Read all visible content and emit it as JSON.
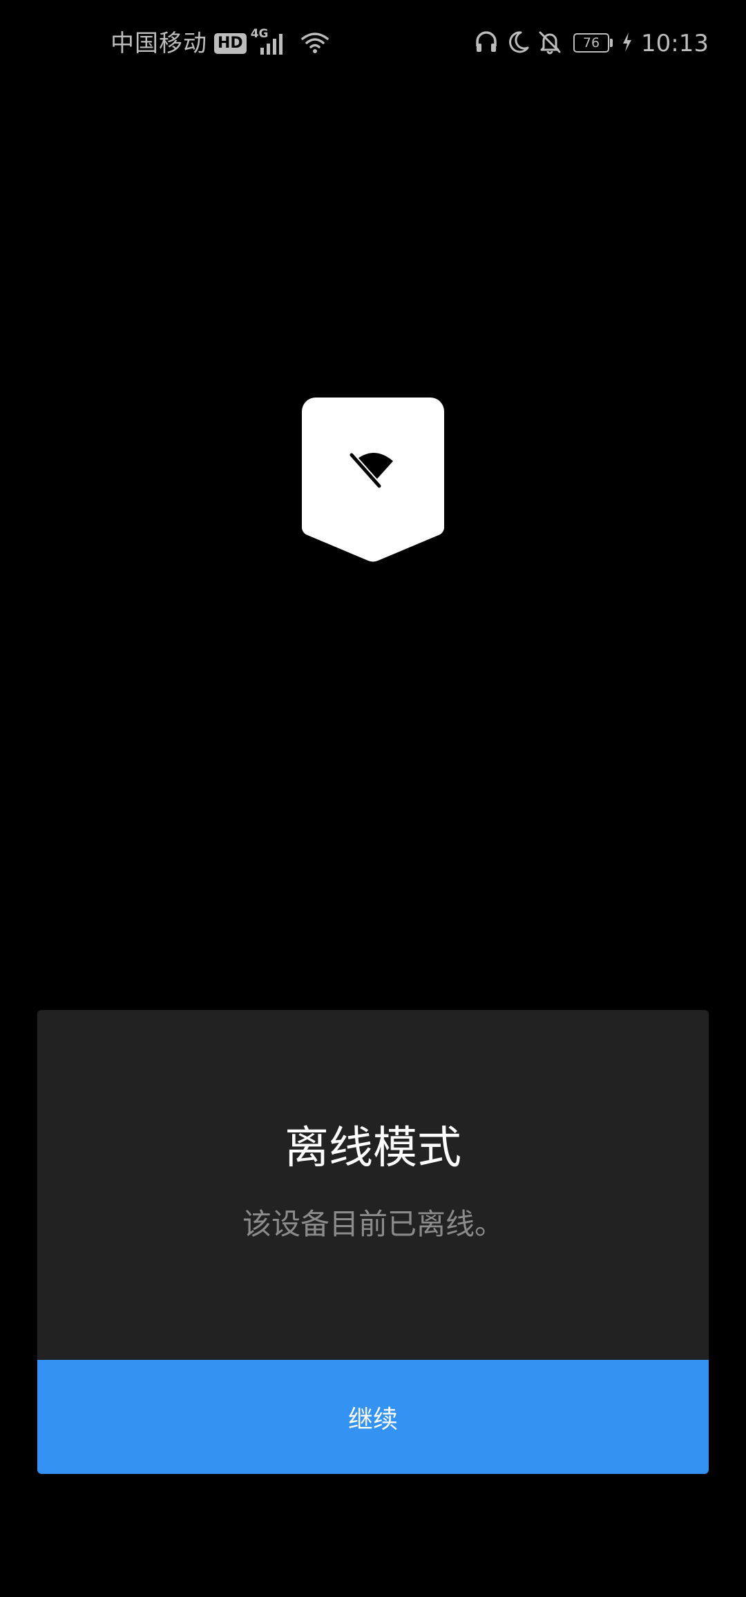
{
  "status_bar": {
    "carrier": "中国移动",
    "hd_badge": "HD",
    "network_type": "4G",
    "battery_level": "76",
    "time": "10:13",
    "icons": [
      "signal-icon",
      "wifi-icon",
      "headset-icon",
      "moon-icon",
      "bell-off-icon",
      "battery-icon",
      "charging-icon"
    ]
  },
  "offline_icon": {
    "name": "wifi-off-icon",
    "badge_color": "#ffffff",
    "glyph_color": "#000000"
  },
  "dialog": {
    "title": "离线模式",
    "message": "该设备目前已离线。",
    "continue_label": "继续",
    "background": "#222222",
    "button_color": "#3392f2"
  }
}
